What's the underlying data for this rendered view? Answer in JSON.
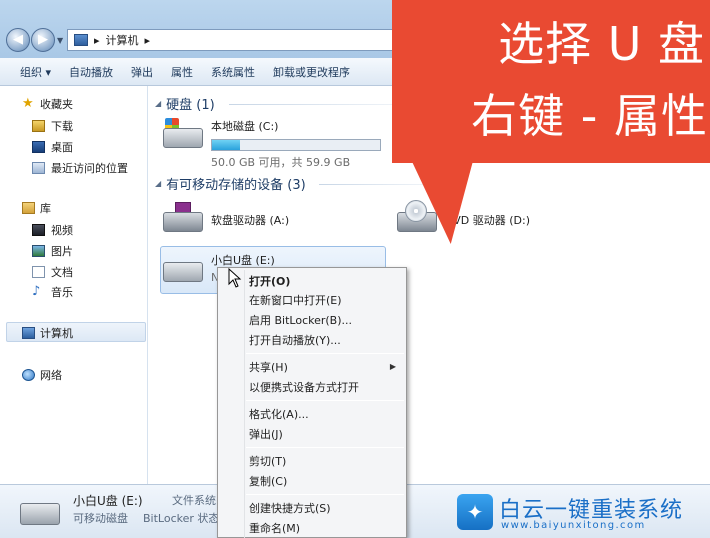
{
  "address": {
    "path": "计算机"
  },
  "toolbar": {
    "items": [
      "组织 ▾",
      "自动播放",
      "弹出",
      "属性",
      "系统属性",
      "卸载或更改程序"
    ]
  },
  "sidebar": {
    "favorites": {
      "label": "收藏夹",
      "items": [
        "下载",
        "桌面",
        "最近访问的位置"
      ]
    },
    "libraries": {
      "label": "库",
      "items": [
        "视频",
        "图片",
        "文档",
        "音乐"
      ]
    },
    "computer": "计算机",
    "network": "网络"
  },
  "main": {
    "hdd_section": "硬盘 (1)",
    "local_disk": {
      "name": "本地磁盘 (C:)",
      "free": "50.0 GB 可用，共 59.9 GB",
      "used_fraction": 0.165
    },
    "removable_section": "有可移动存储的设备 (3)",
    "floppy": "软盘驱动器 (A:)",
    "dvd": "DVD 驱动器 (D:)",
    "usb": {
      "name": "小白U盘 (E:)",
      "sub": "N"
    }
  },
  "details": {
    "name": "小白U盘 (E:)",
    "type": "可移动磁盘",
    "fs": "文件系统",
    "bitlocker": "BitLocker 状态"
  },
  "context_menu": {
    "open": "打开(O)",
    "open_new": "在新窗口中打开(E)",
    "bitlocker": "启用 BitLocker(B)...",
    "autoplay": "打开自动播放(Y)...",
    "share": "共享(H)",
    "portable": "以便携式设备方式打开",
    "format": "格式化(A)...",
    "eject": "弹出(J)",
    "cut": "剪切(T)",
    "copy": "复制(C)",
    "shortcut": "创建快捷方式(S)",
    "rename": "重命名(M)"
  },
  "callout": {
    "line1": "选择 U 盘",
    "line2": "右键 - 属性",
    "color": "#e94a32"
  },
  "watermark": {
    "title": "白云一键重装系统",
    "url": "www.baiyunxitong.com"
  }
}
